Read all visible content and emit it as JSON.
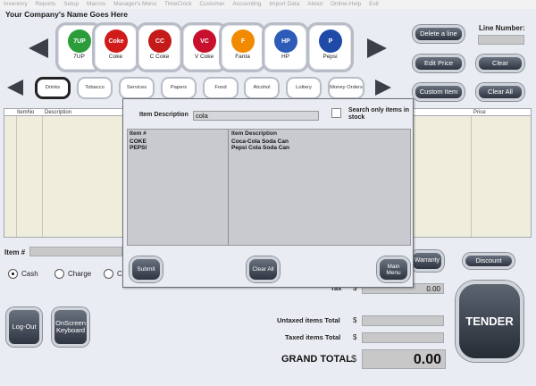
{
  "menu": [
    "Inventory",
    "Reports",
    "Setup",
    "Macros",
    "Manager's Menu",
    "TimeClock",
    "Customer",
    "Accounting",
    "Import Data",
    "About",
    "Online-Help",
    "Exit"
  ],
  "company_name": "Your Company's Name Goes Here",
  "line_number_label": "Line Number:",
  "products": [
    {
      "label": "7UP",
      "color": "#2a9d3a",
      "icon": "7up-logo"
    },
    {
      "label": "Coke",
      "color": "#d11b1b",
      "icon": "coke-logo"
    },
    {
      "label": "C Coke",
      "color": "#c51a1a",
      "icon": "c-coke-logo"
    },
    {
      "label": "V Coke",
      "color": "#c8102e",
      "icon": "v-coke-logo"
    },
    {
      "label": "Fanta",
      "color": "#f28a00",
      "icon": "fanta-logo"
    },
    {
      "label": "HP",
      "color": "#2c5bb8",
      "icon": "hp-logo"
    },
    {
      "label": "Pepsi",
      "color": "#1f4aa8",
      "icon": "pepsi-logo"
    }
  ],
  "categories": [
    "Drinks",
    "Tobacco",
    "Services",
    "Papers",
    "Food",
    "Alcohol",
    "Lottery",
    "Money Orders"
  ],
  "buttons": {
    "delete_line": "Delete a line",
    "edit_price": "Edit Price",
    "clear": "Clear",
    "custom_item": "Custom Item",
    "clear_all": "Clear All",
    "warranty": "Warranty",
    "discount": "Discount",
    "log_out": "Log-Out",
    "onscreen_keyboard": "OnScreen Keyboard",
    "tender": "TENDER"
  },
  "grid": {
    "col_itemno": "ItemNo",
    "col_description": "Description",
    "col_price": "Price"
  },
  "item_label": "Item #",
  "payment": {
    "cash": "Cash",
    "charge": "Charge",
    "other": "C",
    "selected": "Cash"
  },
  "totals": {
    "tax_label": "Tax",
    "tax_value": "0.00",
    "untaxed_label": "Untaxed items Total",
    "untaxed_value": "",
    "taxed_label": "Taxed items Total",
    "taxed_value": "",
    "grand_label": "GRAND TOTAL",
    "grand_value": "0.00",
    "currency": "$"
  },
  "dialog": {
    "desc_label": "Item Description",
    "search_value": "cola",
    "instock_label": "Search only items in stock",
    "col_item": "Item #",
    "col_desc": "Item Description",
    "results": [
      {
        "item": "COKE",
        "desc": "Coca-Cola Soda Can"
      },
      {
        "item": "PEPSI",
        "desc": "Pepsi Cola Soda Can"
      }
    ],
    "submit": "Submit",
    "clear_all": "Clear All",
    "main_menu": "Main Menu"
  }
}
